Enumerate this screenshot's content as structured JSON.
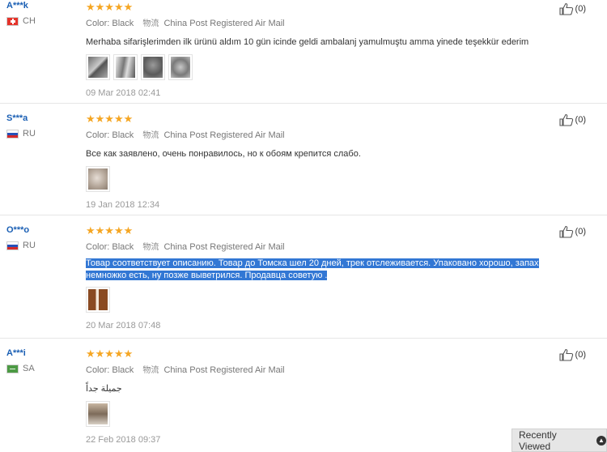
{
  "color_label": "Color:",
  "shipping_icon": "物流",
  "reviews": [
    {
      "user": "A***k",
      "country": "CH",
      "stars": "★★★★★",
      "color": "Black",
      "shipping": "China Post Registered Air Mail",
      "text": "Merhaba sifarişlerimden ilk ürünü aldım 10 gün icinde geldi ambalanj yamulmuştu amma yinede teşekkür ederim",
      "date": "09 Mar 2018 02:41",
      "helpful": "(0)"
    },
    {
      "user": "S***a",
      "country": "RU",
      "stars": "★★★★★",
      "color": "Black",
      "shipping": "China Post Registered Air Mail",
      "text": "Все как заявлено, очень понравилось, но к обоям крепится слабо.",
      "date": "19 Jan 2018 12:34",
      "helpful": "(0)"
    },
    {
      "user": "O***o",
      "country": "RU",
      "stars": "★★★★★",
      "color": "Black",
      "shipping": "China Post Registered Air Mail",
      "text": "Товар соответствует описанию. Товар до Томска шел 20 дней, трек отслеживается. Упаковано хорошо, запах немножко есть, ну позже выветрился. Продавца советую .",
      "date": "20 Mar 2018 07:48",
      "helpful": "(0)"
    },
    {
      "user": "A***i",
      "country": "SA",
      "stars": "★★★★★",
      "color": "Black",
      "shipping": "China Post Registered Air Mail",
      "text": "جميلة جداً",
      "date": "22 Feb 2018 09:37",
      "helpful": "(0)"
    }
  ],
  "recently_viewed": "Recently Viewed"
}
